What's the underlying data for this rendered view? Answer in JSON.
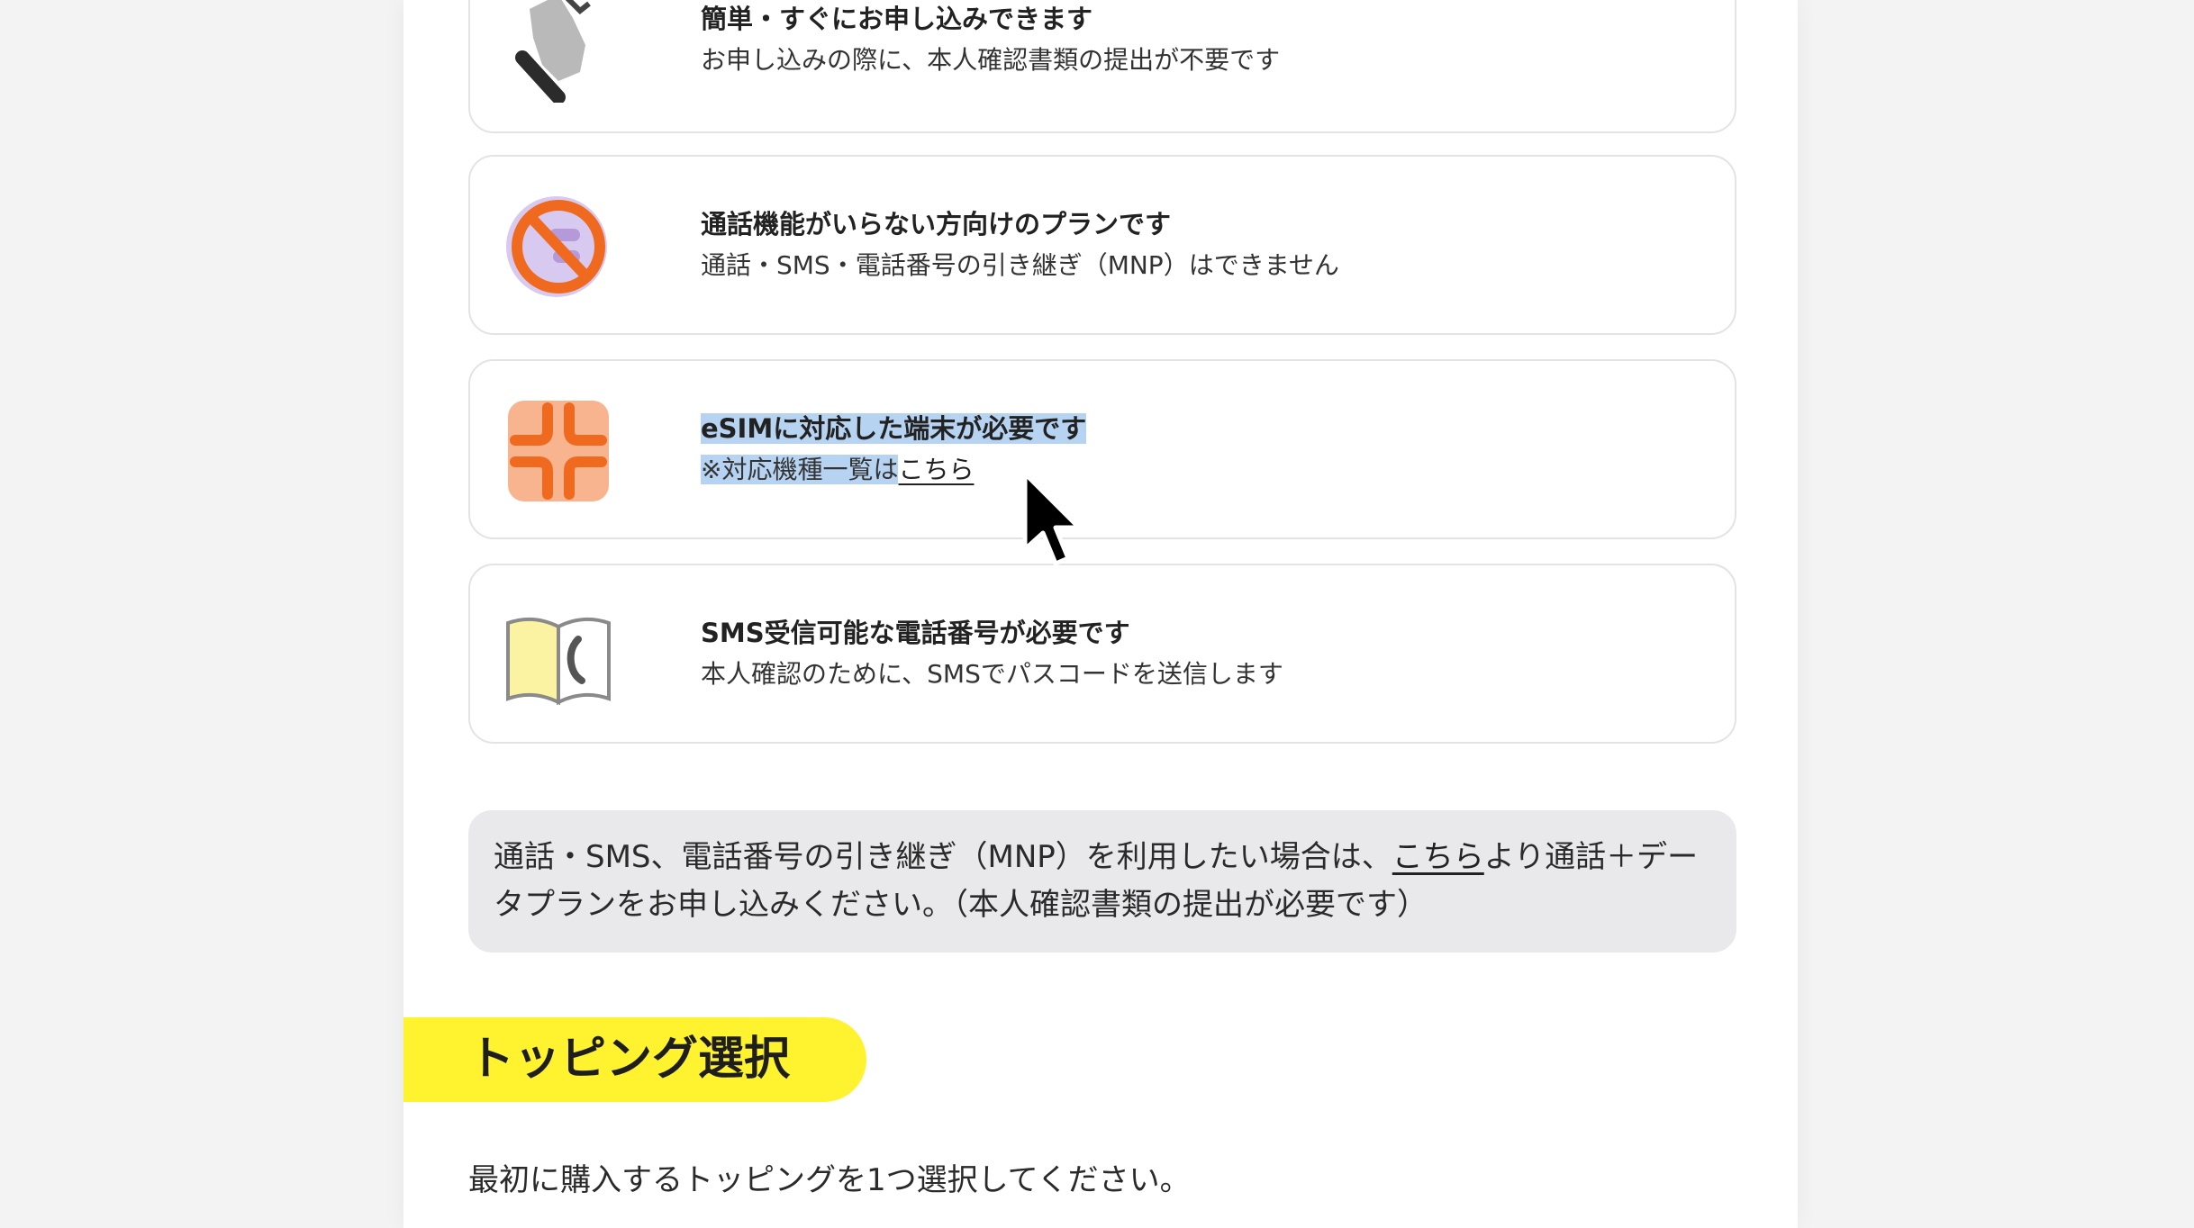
{
  "features": [
    {
      "title": "簡単・すぐにお申し込みできます",
      "desc": "お申し込みの際に、本人確認書類の提出が不要です",
      "icon": "pointing-hand-icon"
    },
    {
      "title": "通話機能がいらない方向けのプランです",
      "desc": "通話・SMS・電話番号の引き継ぎ（MNP）はできません",
      "icon": "no-call-icon"
    },
    {
      "title": "eSIMに対応した端末が必要です",
      "desc": "※対応機種一覧は",
      "link": "こちら",
      "icon": "esim-chip-icon"
    },
    {
      "title": "SMS受信可能な電話番号が必要です",
      "desc": "本人確認のために、SMSでパスコードを送信します",
      "icon": "phone-book-icon"
    }
  ],
  "notice": {
    "before": "通話・SMS、電話番号の引き継ぎ（MNP）を利用したい場合は、",
    "link": "こちら",
    "after": "より通話＋データプランをお申し込みください。（本人確認書類の提出が必要です）"
  },
  "topping": {
    "heading": "トッピング選択",
    "instruction": "最初に購入するトッピングを1つ選択してください。"
  },
  "colors": {
    "highlight": "#b7d3f2",
    "section_label_bg": "#fff22e",
    "notice_bg": "#e9e9ec",
    "icon_orange": "#ef6a1e",
    "icon_purple": "#c9b6e6",
    "icon_yellow": "#fbf3a2"
  }
}
